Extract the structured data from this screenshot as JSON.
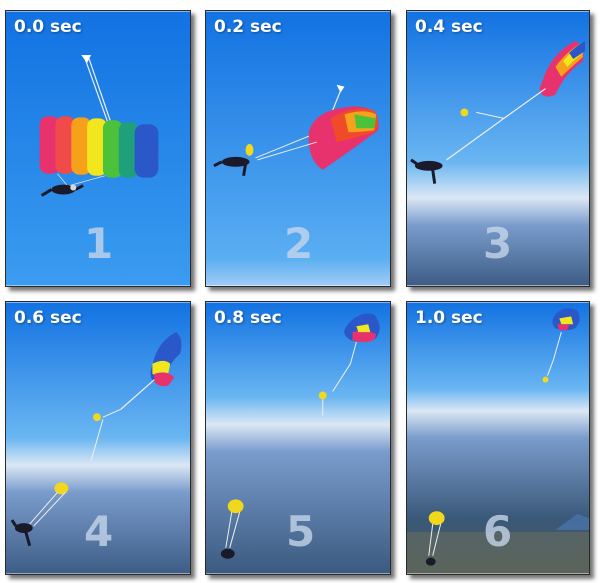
{
  "panels": [
    {
      "time": "0.0 sec",
      "number": "1"
    },
    {
      "time": "0.2 sec",
      "number": "2"
    },
    {
      "time": "0.4 sec",
      "number": "3"
    },
    {
      "time": "0.6 sec",
      "number": "4"
    },
    {
      "time": "0.8 sec",
      "number": "5"
    },
    {
      "time": "1.0 sec",
      "number": "6"
    }
  ],
  "colors": {
    "sky_top": "#1478e6",
    "sky_mid": "#4aa4f0",
    "haze": "#dbe7f4",
    "ground": "#3d5d86",
    "rainbow": [
      "#e8326e",
      "#f04a2a",
      "#f5a21a",
      "#f2e61e",
      "#4cc23a",
      "#2a58c8"
    ],
    "pilot_chute": "#f2d81c"
  }
}
